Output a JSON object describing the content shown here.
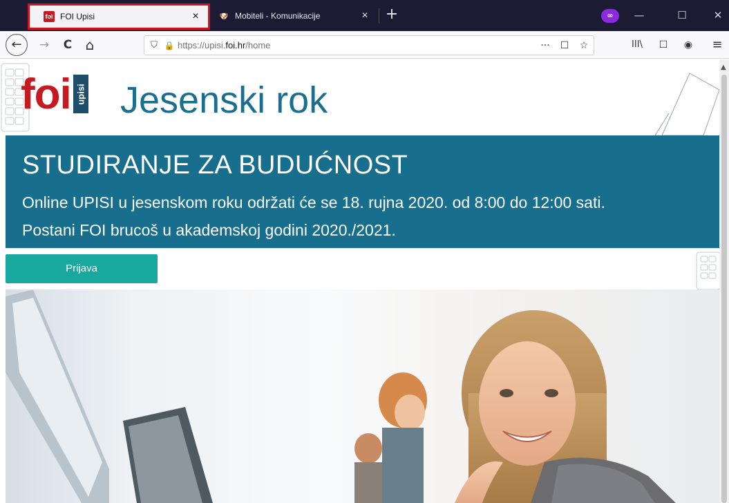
{
  "browser": {
    "tabs": [
      {
        "favicon": "foi",
        "title": "FOI Upisi",
        "close": "×",
        "active": true
      },
      {
        "favicon": "🐶",
        "title": "Mobiteli - Komunikacije",
        "close": "×",
        "active": false
      }
    ],
    "new_tab": "+",
    "window_controls": {
      "minimize": "—",
      "maximize": "☐",
      "close": "✕"
    },
    "private_badge": "∞",
    "nav": {
      "back": "←",
      "forward": "→",
      "reload": "C",
      "home": "⌂",
      "more": "···",
      "pocket": "☐",
      "bookmark": "☆",
      "library": "III\\",
      "sidebar": "☐",
      "account": "◉",
      "menu": "≡"
    },
    "url": {
      "prefix": "https://upisi.",
      "domain": "foi.hr",
      "path": "/home"
    }
  },
  "page": {
    "logo": {
      "foi": "foi",
      "upisi": "upisi"
    },
    "title": "Jesenski rok",
    "banner": {
      "heading": "STUDIRANJE ZA BUDUĆNOST",
      "line1": "Online UPISI u jesenskom roku održati će se 18. rujna 2020. od 8:00 do 12:00 sati.",
      "line2": "Postani FOI brucoš u akademskoj godini 2020./2021."
    },
    "apply_button": "Prijava"
  },
  "colors": {
    "brand_red": "#c51a22",
    "banner_blue": "#176e8d",
    "button_teal": "#19a89d",
    "title_blue": "#1a6e90"
  }
}
